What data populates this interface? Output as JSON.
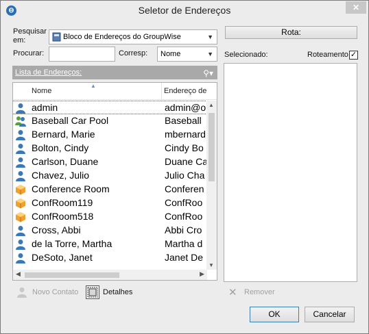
{
  "window": {
    "title": "Seletor de Endereços",
    "close_glyph": "✕"
  },
  "search": {
    "label": "Pesquisar em:",
    "source_value": "Bloco de Endereços do GroupWise",
    "find_label": "Procurar:",
    "find_value": "",
    "match_label": "Corresp:",
    "match_value": "Nome"
  },
  "list": {
    "header": "Lista de Endereços:",
    "col_name": "Nome",
    "col_email": "Endereço de",
    "rows": [
      {
        "name": "admin",
        "email": "admin@o",
        "icon": "user-icon"
      },
      {
        "name": "Baseball Car Pool",
        "email": "Baseball",
        "icon": "group-icon"
      },
      {
        "name": "Bernard, Marie",
        "email": "mbernard",
        "icon": "user-icon"
      },
      {
        "name": "Bolton, Cindy",
        "email": "Cindy Bo",
        "icon": "user-icon"
      },
      {
        "name": "Carlson, Duane",
        "email": "Duane Ca",
        "icon": "user-icon"
      },
      {
        "name": "Chavez, Julio",
        "email": "Julio Cha",
        "icon": "user-icon"
      },
      {
        "name": "Conference Room",
        "email": "Conferen",
        "icon": "resource-icon"
      },
      {
        "name": "ConfRoom119",
        "email": "ConfRoo",
        "icon": "resource-icon"
      },
      {
        "name": "ConfRoom518",
        "email": "ConfRoo",
        "icon": "resource-icon"
      },
      {
        "name": "Cross, Abbi",
        "email": "Abbi Cro",
        "icon": "user-icon"
      },
      {
        "name": "de la Torre, Martha",
        "email": "Martha d",
        "icon": "user-icon"
      },
      {
        "name": "DeSoto, Janet",
        "email": "Janet De",
        "icon": "user-icon"
      }
    ]
  },
  "actions": {
    "new_contact": "Novo Contato",
    "details": "Detalhes",
    "route": "Rota:",
    "selected_label": "Selecionado:",
    "routing_label": "Roteamento",
    "routing_checked": "✓",
    "remove": "Remover",
    "ok": "OK",
    "cancel": "Cancelar"
  },
  "colors": {
    "header_bar": "#a9a9a9",
    "user_icon": "#3d78b6",
    "resource_icon": "#f0a030",
    "group_icon": "#5aa040"
  }
}
